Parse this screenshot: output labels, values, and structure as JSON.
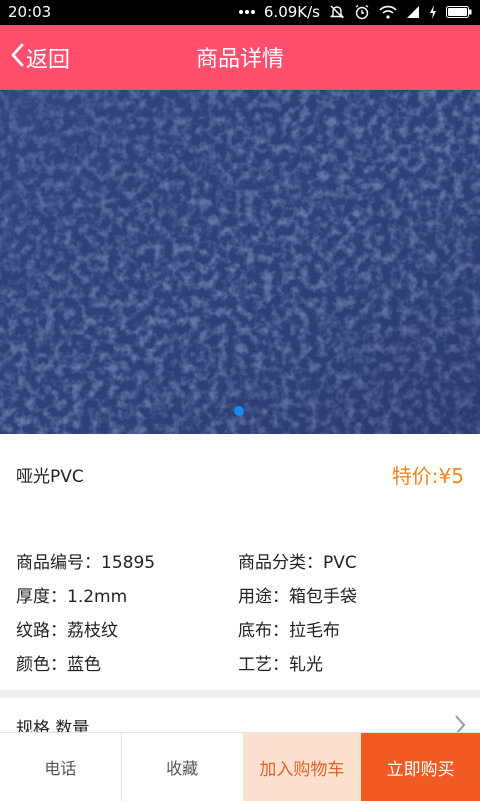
{
  "status_bar": {
    "time": "20:03",
    "network_speed": "6.09K/s"
  },
  "header": {
    "back_label": "返回",
    "title": "商品详情"
  },
  "product": {
    "name": "哑光PVC",
    "price": "特价:¥5"
  },
  "specs": [
    {
      "label": "商品编号：15895"
    },
    {
      "label": "商品分类：PVC"
    },
    {
      "label": "厚度：1.2mm"
    },
    {
      "label": "用途：箱包手袋"
    },
    {
      "label": "纹路：荔枝纹"
    },
    {
      "label": "底布：拉毛布"
    },
    {
      "label": "颜色：蓝色"
    },
    {
      "label": "工艺：轧光"
    }
  ],
  "options_section": {
    "label": "规格,数量"
  },
  "bottom_bar": {
    "phone_label": "电话",
    "favorite_label": "收藏",
    "add_to_cart_label": "加入购物车",
    "buy_now_label": "立即购买"
  },
  "colors": {
    "header_bg": "#ff4f6d",
    "price": "#f0861d",
    "cart_bg": "#fde1cf",
    "buy_bg": "#f15b23",
    "pager_dot": "#1a88f1"
  }
}
